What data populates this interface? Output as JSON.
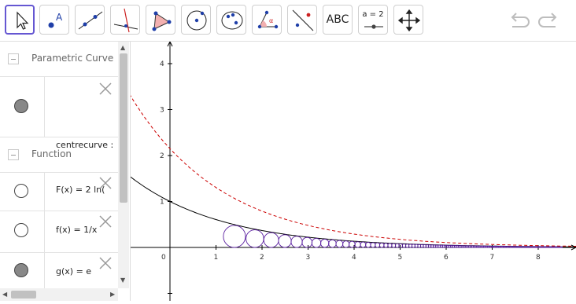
{
  "toolbar": {
    "tools": [
      {
        "name": "move-tool",
        "selected": true
      },
      {
        "name": "point-tool"
      },
      {
        "name": "line-tool"
      },
      {
        "name": "perpendicular-line-tool"
      },
      {
        "name": "polygon-tool"
      },
      {
        "name": "circle-tool"
      },
      {
        "name": "conic-tool"
      },
      {
        "name": "angle-tool"
      },
      {
        "name": "reflect-tool"
      },
      {
        "name": "text-tool",
        "label": "ABC"
      },
      {
        "name": "slider-tool",
        "label": "a = 2"
      },
      {
        "name": "move-graphics-tool"
      }
    ],
    "undo_icon": "undo-icon",
    "redo_icon": "redo-icon"
  },
  "algebra": {
    "groups": [
      {
        "label": "Parametric Curve",
        "items": [
          {
            "text": "centrecurve :",
            "visible": true
          }
        ]
      },
      {
        "label": "Function",
        "items": [
          {
            "text": "F(x) = 2 ln(",
            "visible": false
          },
          {
            "text": "f(x) = 1/x",
            "visible": false
          },
          {
            "text": "g(x) = e",
            "visible": true
          }
        ]
      }
    ]
  },
  "graph": {
    "x_ticks": [
      "0",
      "1",
      "2",
      "3",
      "4",
      "5",
      "6",
      "7",
      "8"
    ],
    "y_ticks": [
      "1",
      "2",
      "3",
      "4"
    ],
    "colors": {
      "solid_curve": "#000000",
      "dashed_curve": "#cc0000",
      "circles": "#5a1fa0",
      "axes": "#000000"
    },
    "circles_r_over_x": 0.35
  }
}
